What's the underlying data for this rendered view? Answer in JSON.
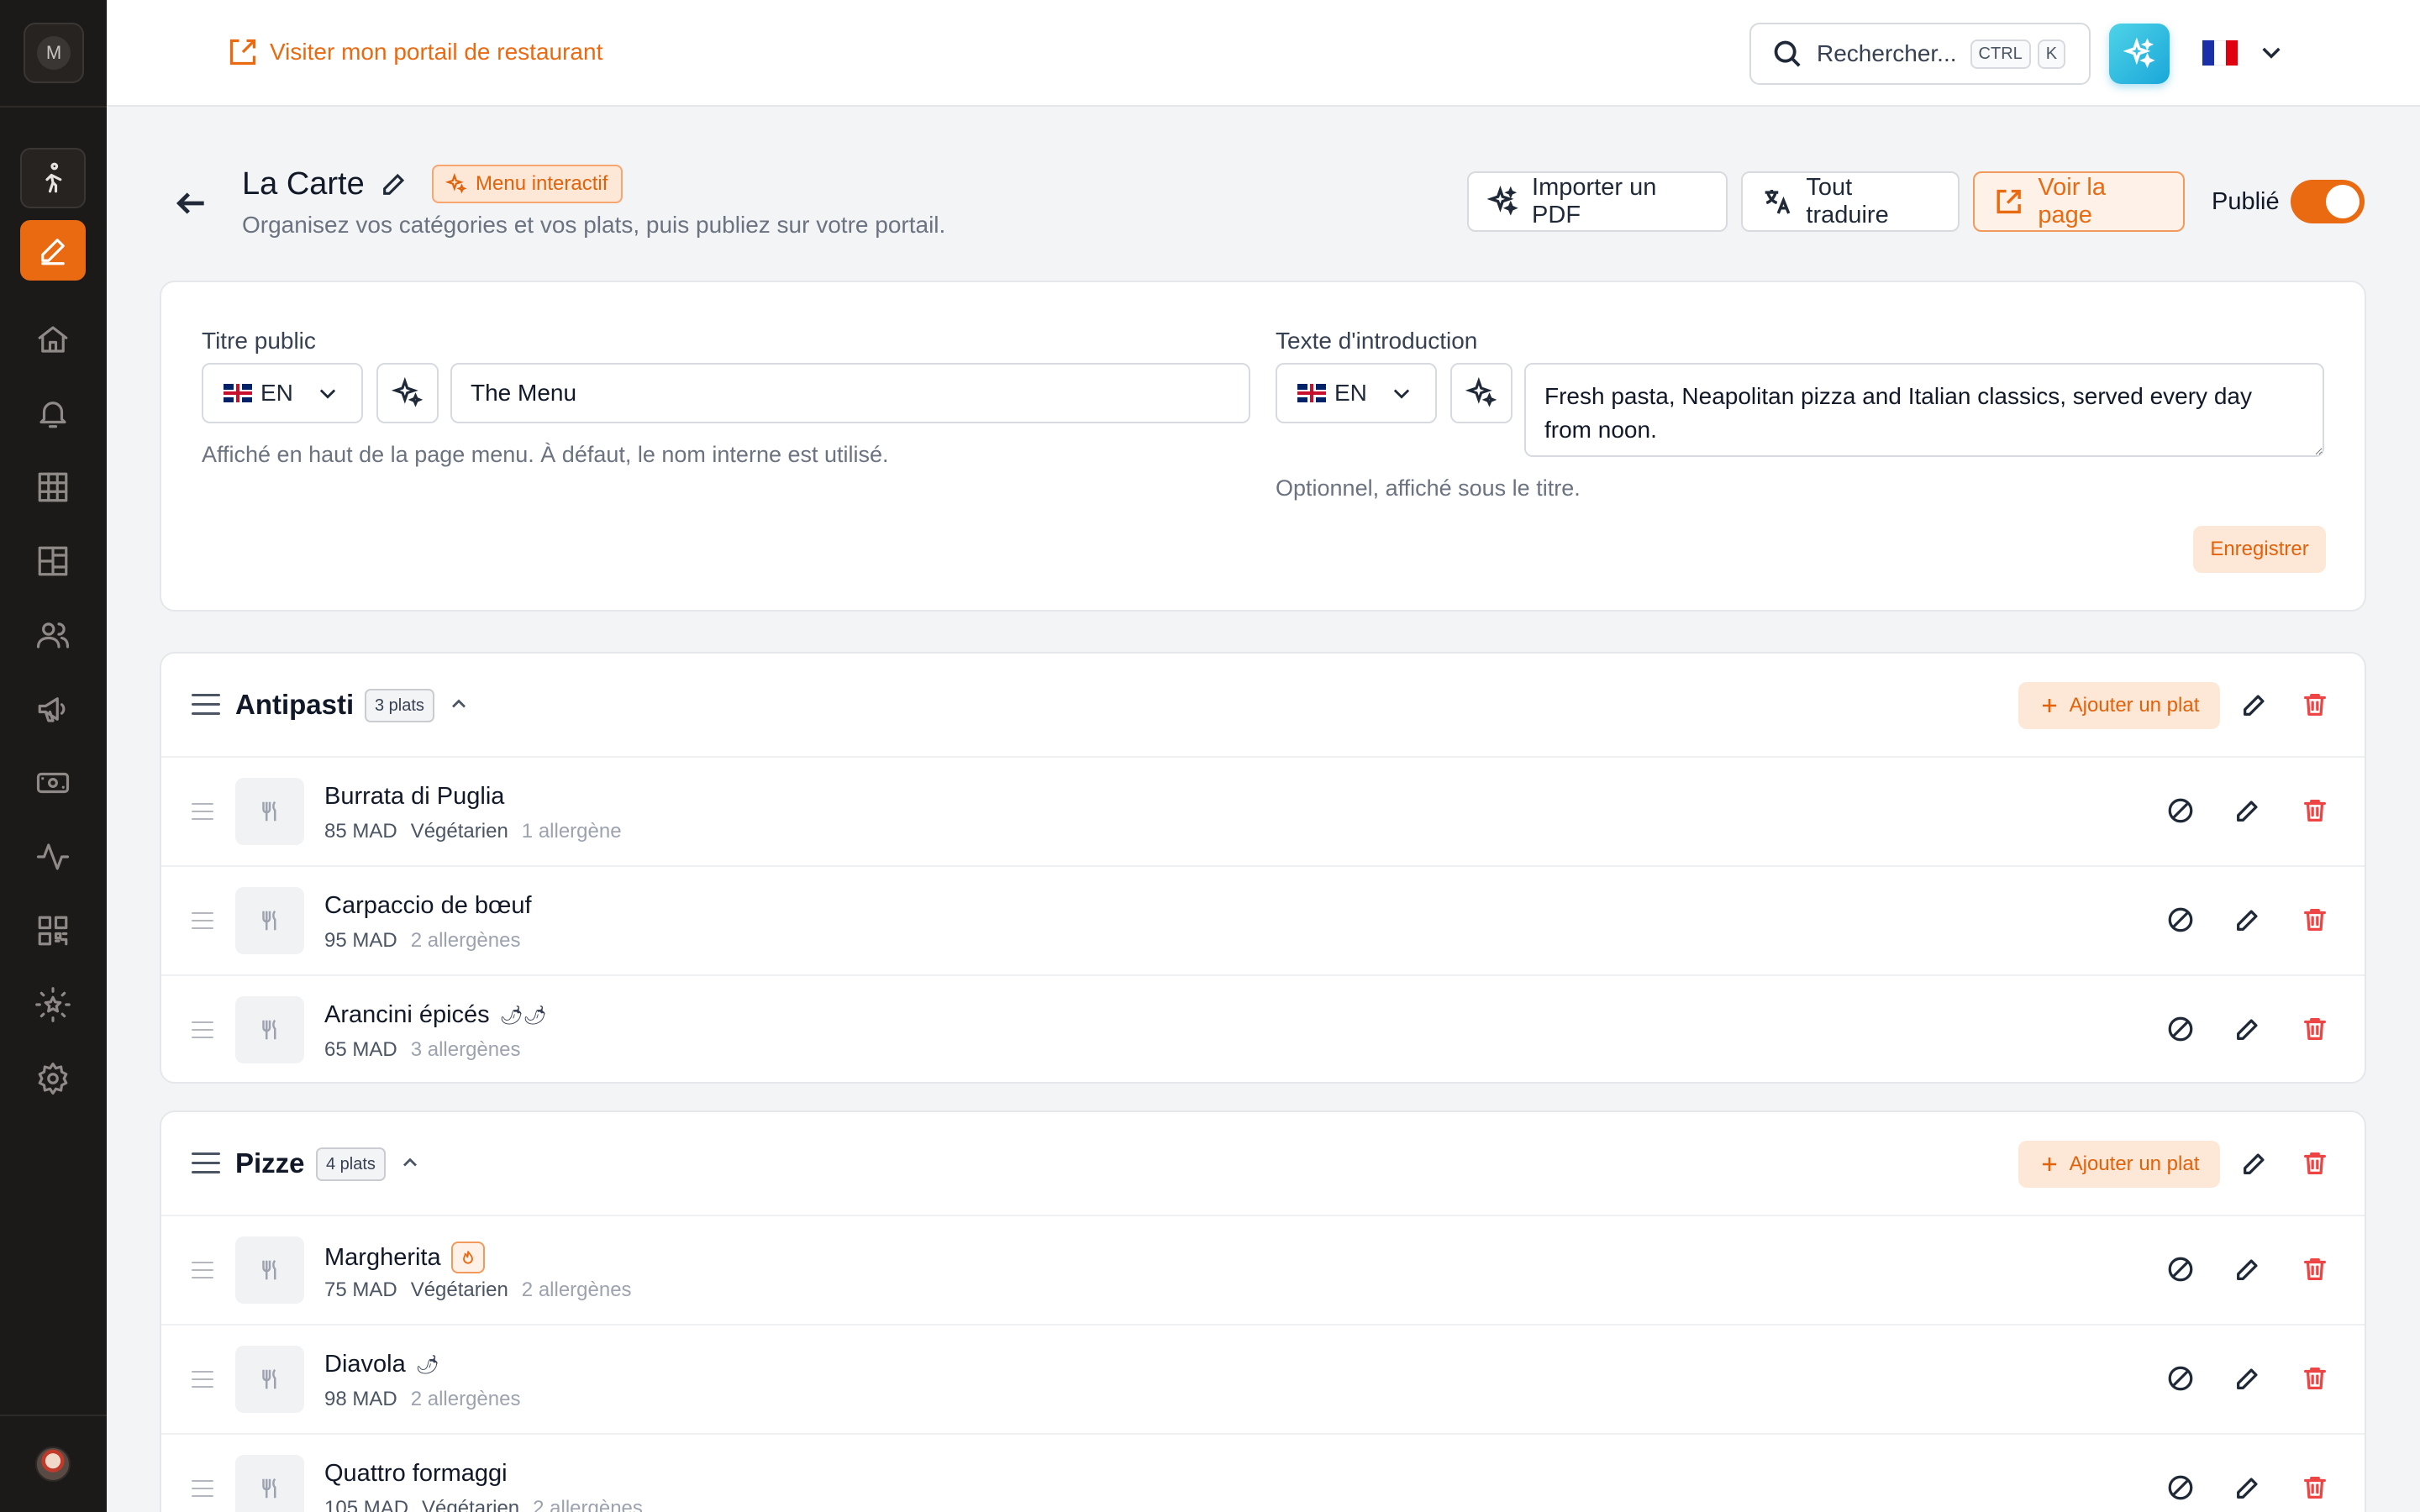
{
  "sidebar": {
    "logo_letter": "M",
    "items": [
      {
        "name": "sidebar-item-walk",
        "icon": "walking-person-icon"
      },
      {
        "name": "sidebar-item-menu-editor",
        "icon": "edit-icon",
        "active": true
      },
      {
        "name": "sidebar-item-home",
        "icon": "home-icon"
      },
      {
        "name": "sidebar-item-notifications",
        "icon": "bell-icon"
      },
      {
        "name": "sidebar-item-tables",
        "icon": "grid-icon"
      },
      {
        "name": "sidebar-item-floor-plan",
        "icon": "layout-icon"
      },
      {
        "name": "sidebar-item-customers",
        "icon": "users-icon"
      },
      {
        "name": "sidebar-item-marketing",
        "icon": "megaphone-icon"
      },
      {
        "name": "sidebar-item-payments",
        "icon": "cash-icon"
      },
      {
        "name": "sidebar-item-analytics",
        "icon": "activity-icon"
      },
      {
        "name": "sidebar-item-qr",
        "icon": "qr-code-icon"
      },
      {
        "name": "sidebar-item-reviews",
        "icon": "star-icon"
      },
      {
        "name": "sidebar-item-settings",
        "icon": "gear-icon"
      }
    ]
  },
  "topbar": {
    "portal_link": "Visiter mon portail de restaurant",
    "search_placeholder": "Rechercher...",
    "shortcut_key1": "CTRL",
    "shortcut_key2": "K",
    "language_flag": "FR"
  },
  "header": {
    "title": "La Carte",
    "badge": "Menu interactif",
    "subtitle": "Organisez vos catégories et vos plats, puis publiez sur votre portail.",
    "import_pdf": "Importer un PDF",
    "translate_all": "Tout traduire",
    "view_page": "Voir la page",
    "published_label": "Publié",
    "published": true
  },
  "settings": {
    "public_title_label": "Titre public",
    "public_title_lang": "EN",
    "public_title_value": "The Menu",
    "public_title_hint": "Affiché en haut de la page menu. À défaut, le nom interne est utilisé.",
    "intro_label": "Texte d'introduction",
    "intro_lang": "EN",
    "intro_value": "Fresh pasta, Neapolitan pizza and Italian classics, served every day from noon.",
    "intro_hint": "Optionnel, affiché sous le titre.",
    "save": "Enregistrer"
  },
  "categories": [
    {
      "name": "Antipasti",
      "count": "3 plats",
      "add_dish": "Ajouter un plat",
      "dishes": [
        {
          "name": "Burrata di Puglia",
          "price": "85 MAD",
          "tag": "Végétarien",
          "allergens": "1 allergène",
          "spicy": ""
        },
        {
          "name": "Carpaccio de bœuf",
          "price": "95 MAD",
          "tag": "",
          "allergens": "2 allergènes",
          "spicy": ""
        },
        {
          "name": "Arancini épicés",
          "price": "65 MAD",
          "tag": "",
          "allergens": "3 allergènes",
          "spicy": "🌶🌶"
        }
      ]
    },
    {
      "name": "Pizze",
      "count": "4 plats",
      "add_dish": "Ajouter un plat",
      "dishes": [
        {
          "name": "Margherita",
          "price": "75 MAD",
          "tag": "Végétarien",
          "allergens": "2 allergènes",
          "spicy": "",
          "badge_icon": "flame-icon"
        },
        {
          "name": "Diavola",
          "price": "98 MAD",
          "tag": "",
          "allergens": "2 allergènes",
          "spicy": "🌶"
        },
        {
          "name": "Quattro formaggi",
          "price": "105 MAD",
          "tag": "Végétarien",
          "allergens": "2 allergènes",
          "spicy": ""
        }
      ]
    }
  ]
}
